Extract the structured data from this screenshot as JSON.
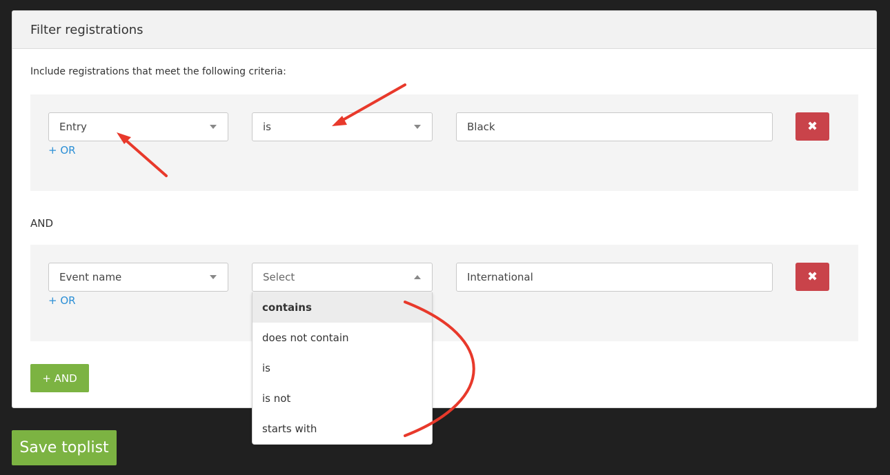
{
  "panel": {
    "title": "Filter registrations",
    "intro": "Include registrations that meet the following criteria:"
  },
  "groups": [
    {
      "field": "Entry",
      "operator": "is",
      "value": "Black",
      "or_label": "+ OR",
      "delete_icon": "close-icon"
    },
    {
      "field": "Event name",
      "operator_placeholder": "Select",
      "value": "International",
      "or_label": "+ OR",
      "delete_icon": "close-icon"
    }
  ],
  "and_separator": "AND",
  "add_and_label": "+ AND",
  "operator_dropdown": {
    "options": [
      "contains",
      "does not contain",
      "is",
      "is not",
      "starts with"
    ],
    "highlighted": "contains"
  },
  "save_label": "Save toplist",
  "colors": {
    "accent_green": "#7cb342",
    "delete_red": "#c9434a",
    "link_blue": "#2b8fd6",
    "annotation_red": "#e8392b"
  }
}
